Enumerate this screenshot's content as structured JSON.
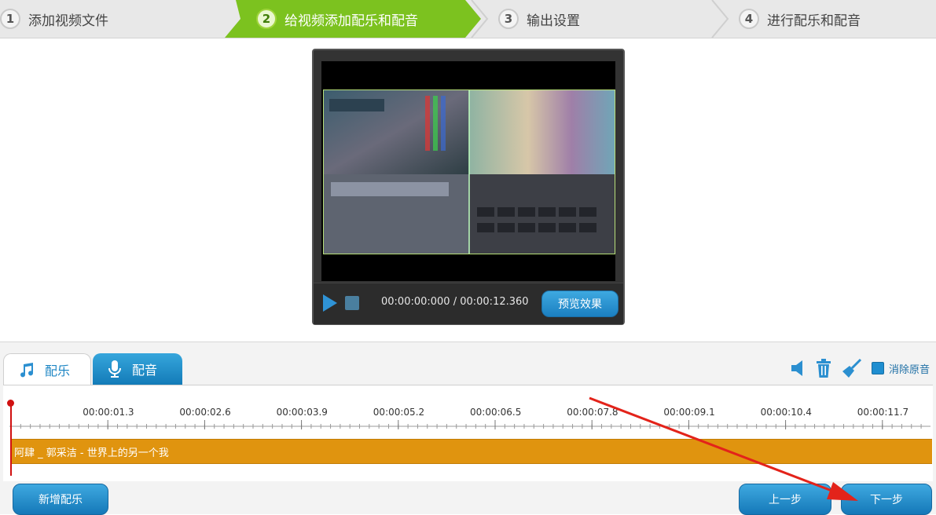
{
  "steps": [
    {
      "num": "1",
      "label": "添加视频文件"
    },
    {
      "num": "2",
      "label": "给视频添加配乐和配音"
    },
    {
      "num": "3",
      "label": "输出设置"
    },
    {
      "num": "4",
      "label": "进行配乐和配音"
    }
  ],
  "player": {
    "time": "00:00:00:000 / 00:00:12.360",
    "preview_label": "预览效果"
  },
  "tabs": {
    "music": "配乐",
    "voice": "配音"
  },
  "toolbar": {
    "mute_original_label": "消除原音"
  },
  "timeline": {
    "ticks": [
      "00:00:01.3",
      "00:00:02.6",
      "00:00:03.9",
      "00:00:05.2",
      "00:00:06.5",
      "00:00:07.8",
      "00:00:09.1",
      "00:00:10.4",
      "00:00:11.7"
    ],
    "track_label": "阿肆 _ 郭采洁 - 世界上的另一个我"
  },
  "buttons": {
    "add_music": "新增配乐",
    "prev": "上一步",
    "next": "下一步"
  },
  "colors": {
    "accent_blue": "#1f8ed0",
    "active_step_green": "#7cc21f",
    "track_orange": "#e0940f",
    "annotation_red": "#e3231a"
  }
}
